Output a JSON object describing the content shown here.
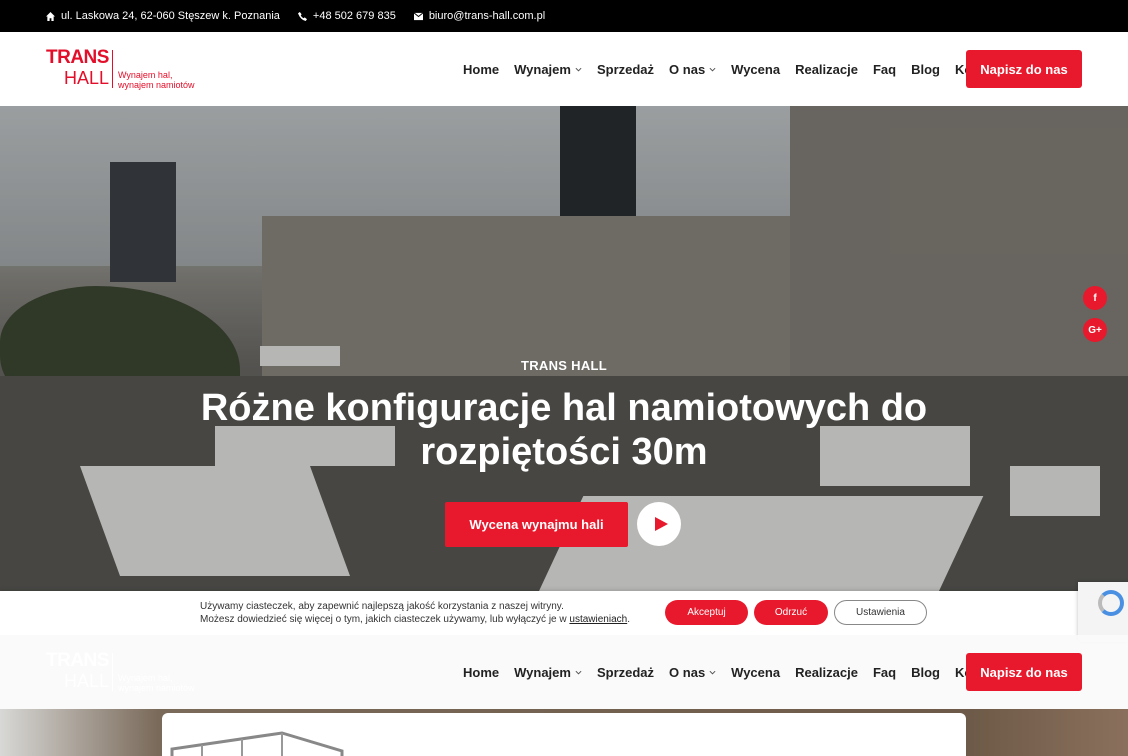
{
  "topbar": {
    "address": "ul. Laskowa 24, 62-060 Stęszew k. Poznania",
    "phone": "+48 502 679 835",
    "email": "biuro@trans-hall.com.pl"
  },
  "logo": {
    "line1": "TRANS",
    "line2": "HALL",
    "tagline1": "Wynajem hal,",
    "tagline2": "wynajem namiotów"
  },
  "nav": {
    "items": [
      {
        "label": "Home",
        "dropdown": false
      },
      {
        "label": "Wynajem",
        "dropdown": true
      },
      {
        "label": "Sprzedaż",
        "dropdown": false
      },
      {
        "label": "O nas",
        "dropdown": true
      },
      {
        "label": "Wycena",
        "dropdown": false
      },
      {
        "label": "Realizacje",
        "dropdown": false
      },
      {
        "label": "Faq",
        "dropdown": false
      },
      {
        "label": "Blog",
        "dropdown": false
      },
      {
        "label": "Kontakt",
        "dropdown": false
      }
    ],
    "cta": "Napisz do nas"
  },
  "hero": {
    "eyebrow": "TRANS HALL",
    "headline_line1": "Różne konfiguracje hal namiotowych do",
    "headline_line2": "rozpiętości 30m",
    "button": "Wycena wynajmu hali"
  },
  "social": {
    "facebook": "f",
    "googleplus": "G+"
  },
  "cookie": {
    "line1": "Używamy ciasteczek, aby zapewnić najlepszą jakość korzystania z naszej witryny.",
    "line2_prefix": "Możesz dowiedzieć się więcej o tym, jakich ciasteczek używamy, lub wyłączyć je w",
    "line2_link": "ustawieniach",
    "line2_suffix": ".",
    "accept": "Akceptuj",
    "reject": "Odrzuć",
    "settings": "Ustawienia"
  },
  "colors": {
    "accent": "#e8192c",
    "topbar": "#000000"
  }
}
